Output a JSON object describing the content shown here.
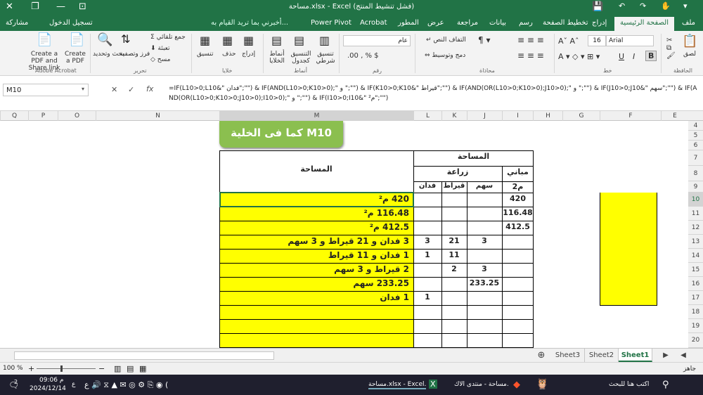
{
  "title_bar": {
    "title": "مساحة.xlsx - Excel (فشل تنشيط المنتج)"
  },
  "tabs": {
    "file": "ملف",
    "home": "الصفحة الرئيسية",
    "insert": "إدراج",
    "page_layout": "تخطيط الصفحة",
    "draw": "رسم",
    "data": "بيانات",
    "review": "مراجعة",
    "view": "عرض",
    "developer": "المطور",
    "acrobat": "Acrobat",
    "power_pivot": "Power Pivot",
    "tell_me": "أخبرني بما تريد القيام به...",
    "sign_in": "تسجيل الدخول",
    "share": "مشاركة"
  },
  "ribbon": {
    "paste": "لصق",
    "clipboard": "الحافظة",
    "font_name": "Arial",
    "font_size": "16",
    "font_group": "خط",
    "wrap_text": "التفاف النص",
    "merge_center": "دمج وتوسيط",
    "alignment": "محاذاة",
    "number_format": "عام",
    "number_group": "رقم",
    "conditional_formatting": "تنسيق شرطي",
    "format_as_table": "التنسيق كجدول",
    "cell_styles": "أنماط الخلايا",
    "styles": "أنماط",
    "insert": "إدراج",
    "delete": "حذف",
    "format": "تنسيق",
    "cells": "خلايا",
    "autosum": "جمع تلقائي",
    "fill": "تعبئة",
    "clear": "مسح",
    "sort_filter": "فرز وتصفية",
    "find_select": "بحث وتحديد",
    "editing": "تحرير",
    "create_pdf_share": "Create a PDF and Share link",
    "create_pdf": "Create a PDF",
    "adobe_acrobat": "Adobe Acrobat"
  },
  "formula_bar": {
    "name_box": "M10",
    "fx": "fx",
    "formula": "=IF(L10>0;L10&\" فدان\";\"\") & IF(AND(L10>0;K10>0);\" و \";\"\") & IF(K10>0;K10&\" قيراط\";\"\") & IF(AND(OR(L10>0;K10>0);J10>0);\" و \";\"\") & IF(J10>0;J10&\" سهم\";\"\") & IF(AND(OR(L10>0;K10>0;J10>0);I10>0);\" و \";\"\") & IF(I10>0;I10&\" م²\";\"\")"
  },
  "columns": [
    "E",
    "F",
    "G",
    "H",
    "I",
    "J",
    "K",
    "L",
    "M",
    "N",
    "O",
    "P",
    "Q"
  ],
  "rows": [
    "4",
    "5",
    "6",
    "7",
    "8",
    "9",
    "10",
    "11",
    "12",
    "13",
    "14",
    "15",
    "16",
    "17",
    "18",
    "19",
    "20"
  ],
  "callout": "كما فى الخلية  M10",
  "table": {
    "header_area": "المساحة",
    "header_area_top": "المساحة",
    "buildings": "مباني",
    "agriculture": "زراعة",
    "m2": "م2",
    "sahm": "سهم",
    "qirat": "قيراط",
    "feddan": "فدان",
    "rows": [
      {
        "m": "420 م²",
        "i": "420",
        "j": "",
        "k": "",
        "l": ""
      },
      {
        "m": "116.48 م²",
        "i": "116.48",
        "j": "",
        "k": "",
        "l": ""
      },
      {
        "m": "412.5 م²",
        "i": "412.5",
        "j": "",
        "k": "",
        "l": ""
      },
      {
        "m": "3 فدان و 21 قيراط و 3 سهم",
        "i": "",
        "j": "3",
        "k": "21",
        "l": "3"
      },
      {
        "m": "1 فدان و 11 قيراط",
        "i": "",
        "j": "",
        "k": "11",
        "l": "1"
      },
      {
        "m": "2 قيراط و 3 سهم",
        "i": "",
        "j": "3",
        "k": "2",
        "l": ""
      },
      {
        "m": "233.25 سهم",
        "i": "",
        "j": "233.25",
        "k": "",
        "l": ""
      },
      {
        "m": "1 فدان",
        "i": "",
        "j": "",
        "k": "",
        "l": "1"
      }
    ]
  },
  "sheets": [
    "Sheet1",
    "Sheet2",
    "Sheet3"
  ],
  "status": {
    "ready": "جاهز",
    "zoom": "100 %"
  },
  "taskbar": {
    "search": "اكتب هنا للبحث",
    "forum_window": "مساحة - منتدى الاك...",
    "excel_window": "مساحة.xlsx - Excel...",
    "time": "09:06 م",
    "date": "2024/12/14",
    "lang": "ع",
    "notif": "2"
  },
  "colors": {
    "excel_green": "#217346",
    "highlight": "#ffff00",
    "callout": "#8bbf4f"
  }
}
